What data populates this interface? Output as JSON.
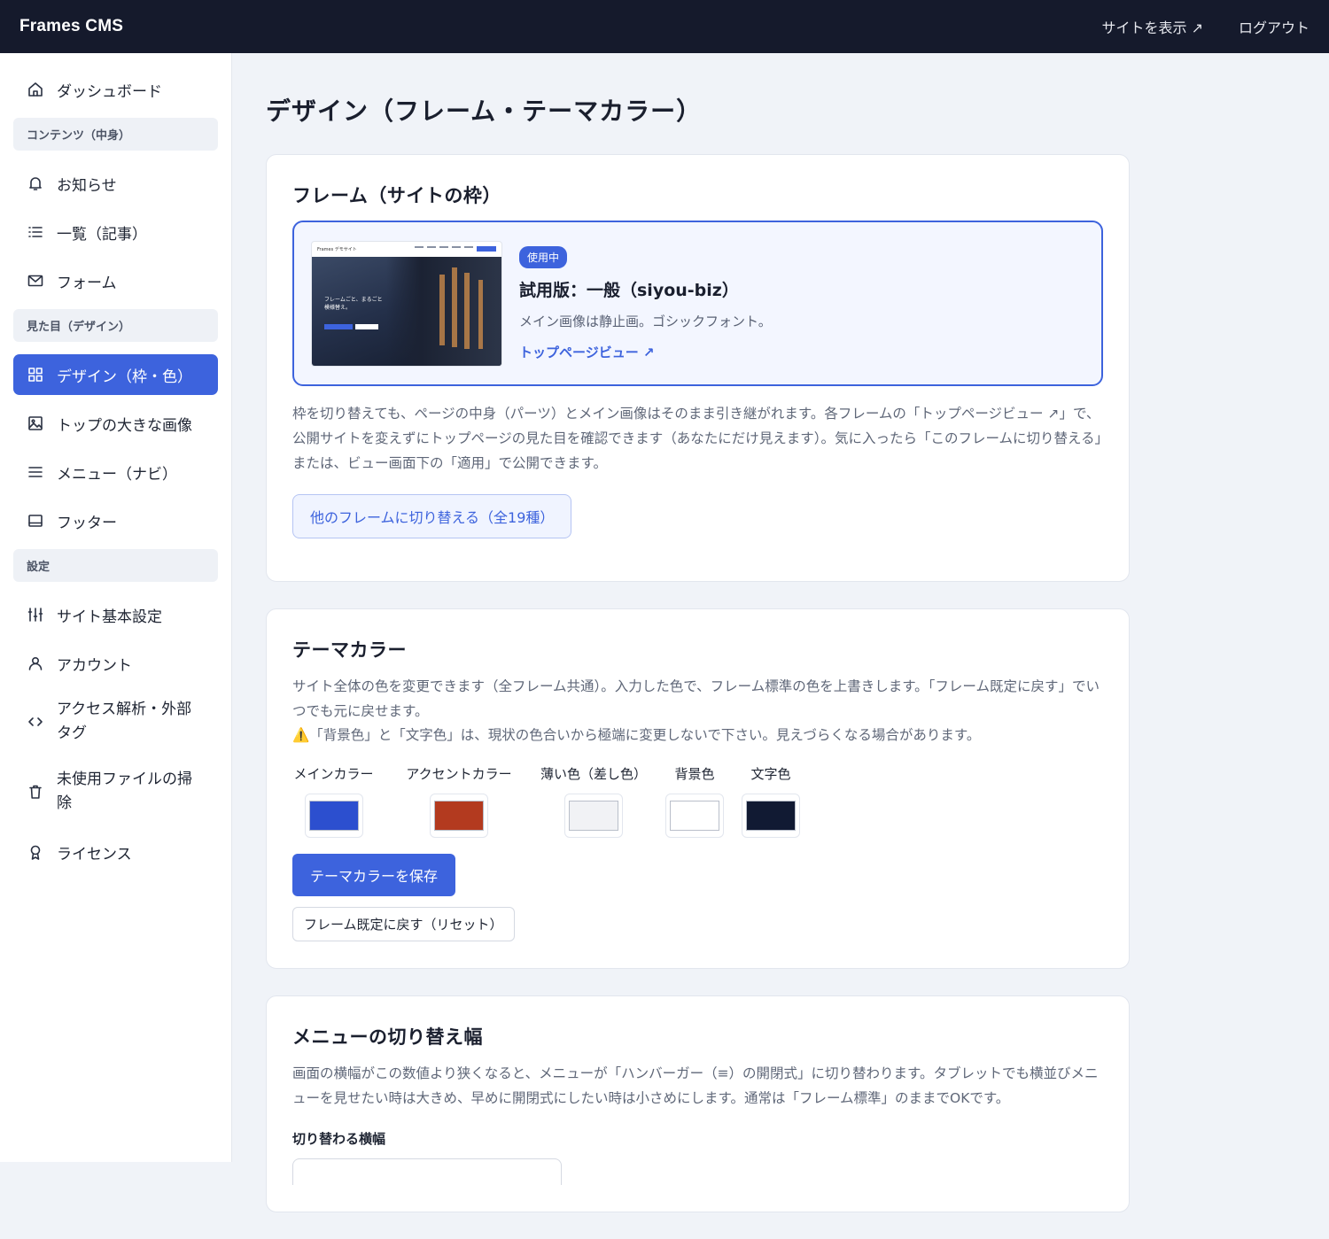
{
  "header": {
    "brand": "Frames CMS",
    "view_site": "サイトを表示 ↗",
    "logout": "ログアウト"
  },
  "sidebar": {
    "dashboard": "ダッシュボード",
    "sections": {
      "content": "コンテンツ（中身）",
      "appearance": "見た目（デザイン）",
      "settings": "設定"
    },
    "content_items": {
      "news": "お知らせ",
      "articles": "一覧（記事）",
      "form": "フォーム"
    },
    "appearance_items": {
      "design": "デザイン（枠・色）",
      "hero": "トップの大きな画像",
      "menu": "メニュー（ナビ）",
      "footer": "フッター"
    },
    "settings_items": {
      "site": "サイト基本設定",
      "account": "アカウント",
      "analytics": "アクセス解析・外部タグ",
      "cleanup": "未使用ファイルの掃除",
      "license": "ライセンス"
    }
  },
  "main": {
    "title": "デザイン（フレーム・テーマカラー）",
    "frame": {
      "heading": "フレーム（サイトの枠）",
      "badge": "使用中",
      "name": "試用版：一般（siyou-biz）",
      "desc": "メイン画像は静止画。ゴシックフォント。",
      "preview_link": "トップページビュー ↗",
      "thumb_brand": "Frames デモサイト",
      "thumb_text": "フレームごと、まるごと模様替え。",
      "explanation": "枠を切り替えても、ページの中身（パーツ）とメイン画像はそのまま引き継がれます。各フレームの「トップページビュー ↗」で、公開サイトを変えずにトップページの見た目を確認できます（あなたにだけ見えます）。気に入ったら「このフレームに切り替える」または、ビュー画面下の「適用」で公開できます。",
      "switch_button": "他のフレームに切り替える（全19種）"
    },
    "theme": {
      "heading": "テーマカラー",
      "desc1": "サイト全体の色を変更できます（全フレーム共通）。入力した色で、フレーム標準の色を上書きします。「フレーム既定に戻す」でいつでも元に戻せます。",
      "warning": "⚠️「背景色」と「文字色」は、現状の色合いから極端に変更しないで下さい。見えづらくなる場合があります。",
      "colors": [
        {
          "label": "メインカラー",
          "value": "#2c4fcf"
        },
        {
          "label": "アクセントカラー",
          "value": "#b33a1f"
        },
        {
          "label": "薄い色（差し色）",
          "value": "#f1f2f5"
        },
        {
          "label": "背景色",
          "value": "#ffffff"
        },
        {
          "label": "文字色",
          "value": "#111a33"
        }
      ],
      "save_button": "テーマカラーを保存",
      "reset_button": "フレーム既定に戻す（リセット）"
    },
    "menu_width": {
      "heading": "メニューの切り替え幅",
      "desc": "画面の横幅がこの数値より狭くなると、メニューが「ハンバーガー（≡）の開閉式」に切り替わります。タブレットでも横並びメニューを見せたい時は大きめ、早めに開閉式にしたい時は小さめにします。通常は「フレーム標準」のままでOKです。",
      "field_label": "切り替わる横幅"
    }
  }
}
